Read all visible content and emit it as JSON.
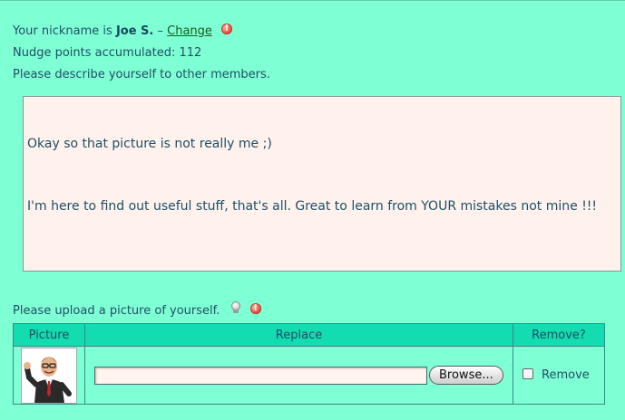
{
  "profile": {
    "nickname_prefix": "Your nickname is",
    "nickname": "Joe S.",
    "nickname_sep": " – ",
    "change_label": "Change",
    "warning_glyph": "!",
    "points_label": "Nudge points accumulated:",
    "points_value": "112",
    "describe_prompt": "Please describe yourself to other members."
  },
  "description": {
    "line1": "Okay so that picture is not really me ;)",
    "line2": "I'm here to find out useful stuff, that's all. Great to learn from YOUR mistakes not mine !!!"
  },
  "upload": {
    "prompt": "Please upload a picture of yourself.",
    "warning_glyph": "!"
  },
  "picture_table": {
    "headers": [
      "Picture",
      "Replace",
      "Remove?"
    ],
    "browse_label": "Browse...",
    "remove_label": "Remove"
  },
  "colors": {
    "background": "#7fffd4",
    "header_bg": "#12dcb0",
    "text": "#1f4f66",
    "textarea_bg": "#fff2ec"
  },
  "icons": [
    "warning-icon",
    "lightbulb-icon"
  ]
}
